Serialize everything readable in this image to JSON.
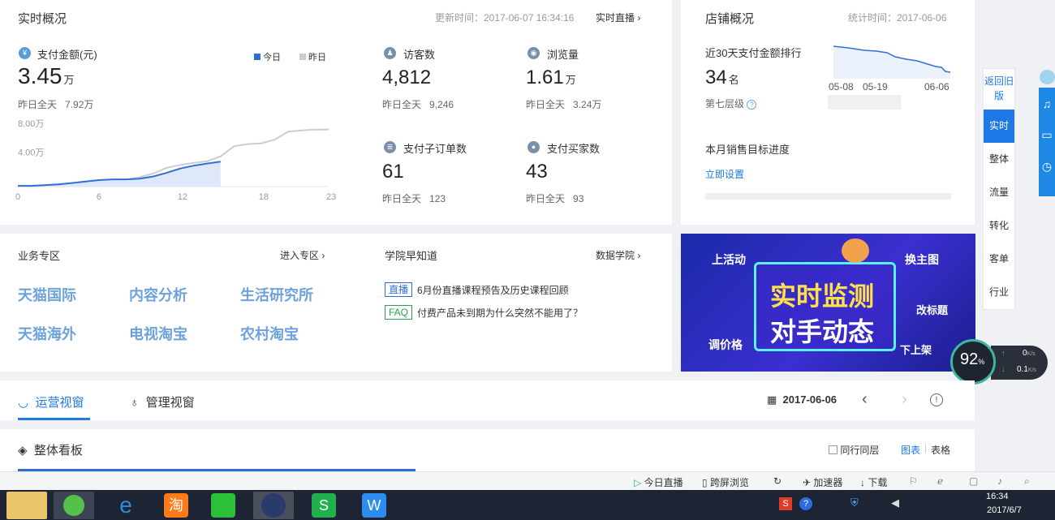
{
  "realtime": {
    "title": "实时概况",
    "update_time": "更新时间：2017-06-07 16:34:16",
    "live_link": "实时直播",
    "pay_amount": {
      "label": "支付金额(元)",
      "value": "3.45",
      "unit": "万",
      "yesterday_label": "昨日全天",
      "yesterday_value": "7.92万"
    },
    "legend": {
      "today": "今日",
      "yesterday": "昨日"
    },
    "visitors": {
      "label": "访客数",
      "value": "4,812",
      "yesterday_label": "昨日全天",
      "yesterday_value": "9,246"
    },
    "pageviews": {
      "label": "浏览量",
      "value": "1.61",
      "unit": "万",
      "yesterday_label": "昨日全天",
      "yesterday_value": "3.24万"
    },
    "sub_orders": {
      "label": "支付子订单数",
      "value": "61",
      "yesterday_label": "昨日全天",
      "yesterday_value": "123"
    },
    "buyers": {
      "label": "支付买家数",
      "value": "43",
      "yesterday_label": "昨日全天",
      "yesterday_value": "93"
    }
  },
  "chart_data": {
    "type": "area",
    "title": "",
    "x": [
      0,
      1,
      2,
      3,
      4,
      5,
      6,
      7,
      8,
      9,
      10,
      11,
      12,
      13,
      14,
      15,
      16,
      17,
      18,
      19,
      20,
      21,
      22,
      23
    ],
    "y_ticks": [
      "8.00万",
      "4.00万"
    ],
    "x_ticks": [
      "0",
      "6",
      "12",
      "18",
      "23"
    ],
    "ylim": [
      0,
      9
    ],
    "series": [
      {
        "name": "昨日",
        "color": "#cccccc",
        "values": [
          0.1,
          0.1,
          0.2,
          0.3,
          0.4,
          0.5,
          0.6,
          0.7,
          0.9,
          1.3,
          1.8,
          2.6,
          3.0,
          3.3,
          3.5,
          4.2,
          5.6,
          5.9,
          6.0,
          6.5,
          7.6,
          7.8,
          7.9,
          7.92
        ]
      },
      {
        "name": "今日",
        "color": "#2f6fd6",
        "values": [
          0.1,
          0.1,
          0.2,
          0.3,
          0.5,
          0.7,
          0.9,
          1.0,
          1.0,
          1.1,
          1.4,
          1.9,
          2.5,
          2.9,
          3.2,
          3.45
        ]
      }
    ]
  },
  "store": {
    "title": "店铺概况",
    "stat_time": "统计时间：2017-06-06",
    "rank_label": "近30天支付金额排行",
    "rank_value": "34",
    "rank_unit": "名",
    "level": "第七层级",
    "mini_x": [
      "05-08",
      "05-19",
      "06-06"
    ],
    "target_label": "本月销售目标进度",
    "set_link": "立即设置"
  },
  "business": {
    "title": "业务专区",
    "enter": "进入专区",
    "items": [
      "天猫国际",
      "内容分析",
      "生活研究所",
      "天猫海外",
      "电视淘宝",
      "农村淘宝"
    ]
  },
  "academy": {
    "title": "学院早知道",
    "link": "数据学院",
    "items": [
      {
        "tag": "直播",
        "text": "6月份直播课程预告及历史课程回顾"
      },
      {
        "tag": "FAQ",
        "text": "付费产品未到期为什么突然不能用了？"
      }
    ]
  },
  "banner": {
    "headline1": "实时监测",
    "headline2": "对手动态",
    "labels": [
      "上活动",
      "换主图",
      "改标题",
      "调价格",
      "下上架"
    ]
  },
  "tabs": {
    "ops": "运营视窗",
    "mgmt": "管理视窗",
    "date": "2017-06-06"
  },
  "board": {
    "title": "整体看板",
    "compare": "同行同层",
    "chart": "图表",
    "table": "表格"
  },
  "side_nav": {
    "back": "返回旧版",
    "items": [
      "实时",
      "整体",
      "流量",
      "转化",
      "客单",
      "行业"
    ]
  },
  "speed": {
    "percent": "92",
    "up": "0",
    "down": "0.1",
    "unit": "K/s"
  },
  "status_bar": [
    "今日直播",
    "跨屏浏览",
    "加速器",
    "下载"
  ],
  "clock": {
    "time": "16:34",
    "date": "2017/6/7"
  },
  "colors": {
    "accent": "#1e78e6",
    "biz_link": "#6ea2dc",
    "live_tag": "#2f6fd6",
    "faq_tag": "#2e9e52"
  }
}
